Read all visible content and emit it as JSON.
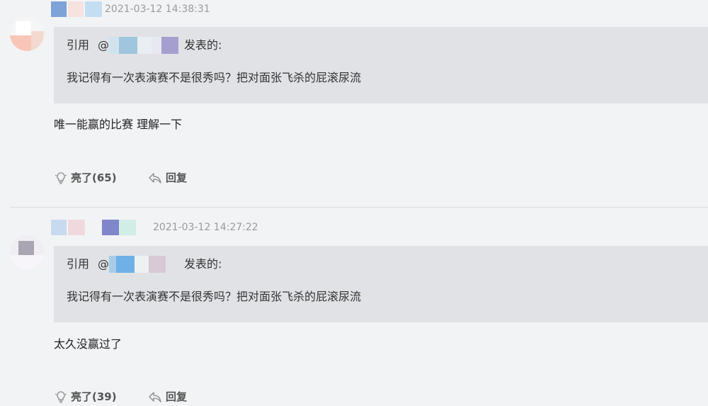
{
  "comments": [
    {
      "timestamp": "2021-03-12 14:38:31",
      "quote_label": "引用",
      "quote_at": "@",
      "quote_action": "发表的:",
      "quote_text": "我记得有一次表演赛不是很秀吗？把对面张飞杀的屁滚尿流",
      "content": "唯一能赢的比赛 理解一下",
      "like_label": "亮了(65)",
      "reply_label": "回复",
      "username_colors": [
        "#7ea3d6",
        "#f6e3e0",
        "#c4def1"
      ],
      "quote_name_colors": [
        "#9fc6de",
        "#e8eef2",
        "#a59fd0"
      ]
    },
    {
      "timestamp": "2021-03-12 14:27:22",
      "quote_label": "引用",
      "quote_at": "@",
      "quote_action": "发表的:",
      "quote_text": "我记得有一次表演赛不是很秀吗？把对面张飞杀的屁滚尿流",
      "content": "太久没赢过了",
      "like_label": "亮了(39)",
      "reply_label": "回复",
      "username_colors": [
        "#c7daf0",
        "#f0d9dc",
        "#7f86c9",
        "#d2ece6"
      ],
      "quote_name_colors": [
        "#6fb0e6",
        "#eef1f1",
        "#d8c9d6"
      ]
    }
  ],
  "icons": {
    "like": "lightbulb-like-icon",
    "reply": "reply-arrow-icon"
  }
}
